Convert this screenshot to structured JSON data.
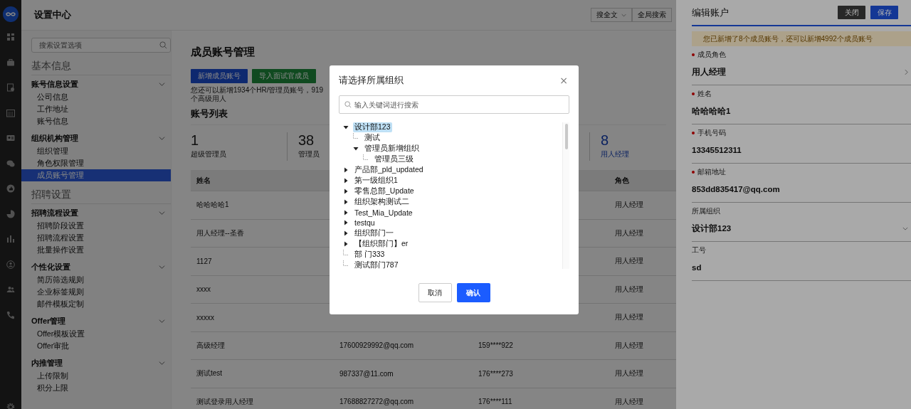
{
  "app": {
    "title": "设置中心"
  },
  "sidebar": {
    "search_placeholder": "搜索设置选项",
    "sections": [
      {
        "title": "基本信息",
        "groups": [
          {
            "title": "账号信息设置",
            "expanded": true,
            "items": [
              {
                "label": "公司信息",
                "selected": false
              },
              {
                "label": "工作地址",
                "selected": false
              },
              {
                "label": "账号信息",
                "selected": false
              }
            ]
          },
          {
            "title": "组织机构管理",
            "expanded": true,
            "items": [
              {
                "label": "组织管理",
                "selected": false
              },
              {
                "label": "角色权限管理",
                "selected": false
              },
              {
                "label": "成员账号管理",
                "selected": true
              }
            ]
          }
        ]
      },
      {
        "title": "招聘设置",
        "groups": [
          {
            "title": "招聘流程设置",
            "expanded": true,
            "items": [
              {
                "label": "招聘阶段设置",
                "selected": false
              },
              {
                "label": "招聘流程设置",
                "selected": false
              },
              {
                "label": "批量操作设置",
                "selected": false
              }
            ]
          },
          {
            "title": "个性化设置",
            "expanded": true,
            "items": [
              {
                "label": "简历筛选规则",
                "selected": false
              },
              {
                "label": "企业标签规则",
                "selected": false
              },
              {
                "label": "邮件模板定制",
                "selected": false
              }
            ]
          },
          {
            "title": "Offer管理",
            "expanded": true,
            "items": [
              {
                "label": "Offer模板设置",
                "selected": false
              },
              {
                "label": "Offer审批",
                "selected": false
              }
            ]
          },
          {
            "title": "内推管理",
            "expanded": true,
            "items": [
              {
                "label": "上传限制",
                "selected": false
              },
              {
                "label": "积分上限",
                "selected": false
              }
            ]
          }
        ]
      }
    ]
  },
  "header_search": {
    "scope": "搜全文",
    "button": "全局搜索"
  },
  "page": {
    "title": "成员账号管理",
    "buttons": [
      {
        "label": "新增成员账号",
        "kind": "primary"
      },
      {
        "label": "导入面试官成员",
        "kind": "success"
      }
    ],
    "note": "您还可以新增1934个HR/管理员账号，919个高级用人",
    "list_title": "账号列表",
    "stats": [
      {
        "value": "1",
        "label": "超级管理员",
        "selected": false
      },
      {
        "value": "38",
        "label": "管理员",
        "selected": false
      },
      {
        "value": "8",
        "label": "用人经理",
        "selected": true
      }
    ]
  },
  "table": {
    "columns": {
      "name": "姓名",
      "role": "角色"
    },
    "rows": [
      {
        "name": "哈哈哈哈1",
        "role": "用人经理"
      },
      {
        "name": "用人经理--圣香",
        "role": "用人经理"
      },
      {
        "name": "1127",
        "role": "用人经理"
      },
      {
        "name": "xxxx",
        "role": "用人经理"
      },
      {
        "name": "xxxxx",
        "role": "用人经理"
      },
      {
        "name": "高级经理",
        "email": "17600929992@qq.com",
        "phone": "159****922",
        "role": "用人经理"
      },
      {
        "name": "测试test",
        "email": "987337@11.com",
        "phone": "176****273",
        "role": "用人经理"
      },
      {
        "name": "测试登录用人经理",
        "email": "17688827272@qq.com",
        "phone": "176****111",
        "role": "用人经理"
      }
    ]
  },
  "drawer": {
    "title": "编辑账户",
    "buttons": [
      {
        "label": "关闭",
        "kind": "secondary"
      },
      {
        "label": "保存",
        "kind": "primary"
      }
    ],
    "notice": "您已新增了8个成员账号，还可以新增4992个成员账号",
    "fields": [
      {
        "label": "成员角色",
        "required": true,
        "value": "用人经理",
        "kind": "picker"
      },
      {
        "label": "姓名",
        "required": true,
        "value": "哈哈哈哈1",
        "kind": "text"
      },
      {
        "label": "手机号码",
        "required": true,
        "value": "13345512311",
        "kind": "text"
      },
      {
        "label": "邮箱地址",
        "required": true,
        "value": "853dd835417@qq.com",
        "kind": "text"
      },
      {
        "label": "所属组织",
        "required": false,
        "value": "设计部123",
        "kind": "dropdown"
      },
      {
        "label": "工号",
        "required": false,
        "value": "sd",
        "kind": "text"
      }
    ]
  },
  "dialog": {
    "title": "请选择所属组织",
    "close": "×",
    "search_placeholder": "输入关键词进行搜索",
    "tree": [
      {
        "label": "设计部123",
        "kind": "branch",
        "expanded": true,
        "selected": true,
        "children": [
          {
            "label": "测试",
            "kind": "leaf",
            "selected": false
          },
          {
            "label": "管理员新增组织",
            "kind": "branch",
            "expanded": true,
            "selected": false,
            "children": [
              {
                "label": "管理员三级",
                "kind": "leaf",
                "selected": false
              }
            ]
          }
        ]
      },
      {
        "label": "产品部_pld_updated",
        "kind": "branch",
        "expanded": false,
        "selected": false
      },
      {
        "label": "第一级组织1",
        "kind": "branch",
        "expanded": false,
        "selected": false
      },
      {
        "label": "零售总部_Update",
        "kind": "branch",
        "expanded": false,
        "selected": false
      },
      {
        "label": "组织架构测试二",
        "kind": "branch",
        "expanded": false,
        "selected": false
      },
      {
        "label": "Test_Mia_Update",
        "kind": "branch",
        "expanded": false,
        "selected": false
      },
      {
        "label": "testqu",
        "kind": "branch",
        "expanded": false,
        "selected": false
      },
      {
        "label": "组织部门一",
        "kind": "branch",
        "expanded": false,
        "selected": false
      },
      {
        "label": "【组织部门】er",
        "kind": "branch",
        "expanded": false,
        "selected": false
      },
      {
        "label": "部 门333",
        "kind": "leaf",
        "selected": false
      },
      {
        "label": "测试部门787",
        "kind": "leaf",
        "selected": false
      }
    ],
    "buttons": [
      {
        "label": "取消",
        "kind": "secondary"
      },
      {
        "label": "确认",
        "kind": "primary"
      }
    ]
  }
}
